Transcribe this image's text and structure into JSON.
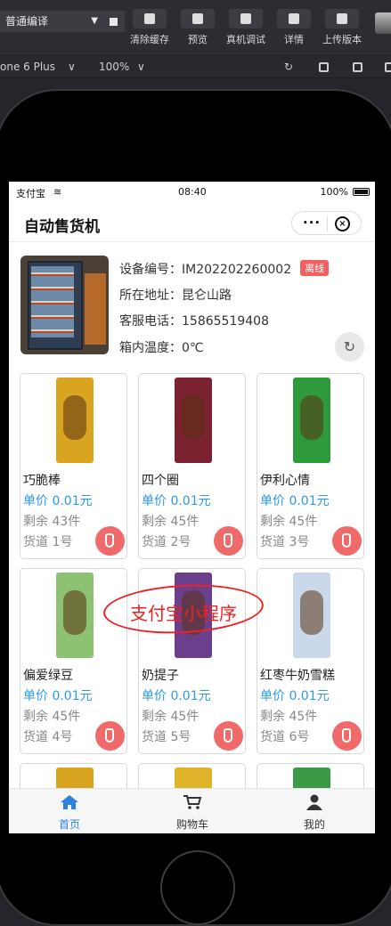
{
  "toolbar": {
    "compile_mode": "普通编译",
    "tools": [
      {
        "label": "清除缓存",
        "icon": "clear-cache-icon"
      },
      {
        "label": "预览",
        "icon": "preview-icon"
      },
      {
        "label": "真机调试",
        "icon": "debug-icon"
      },
      {
        "label": "详情",
        "icon": "details-icon"
      },
      {
        "label": "上传版本",
        "icon": "upload-icon"
      }
    ]
  },
  "device_bar": {
    "device": "one 6 Plus",
    "zoom": "100%"
  },
  "status_bar": {
    "carrier": "支付宝",
    "time": "08:40",
    "battery": "100%"
  },
  "navbar": {
    "title": "自动售货机",
    "more": "···",
    "close": "×"
  },
  "machine_info": {
    "device_no_label": "设备编号：",
    "device_no": "IM202202260002",
    "status_badge": "离线",
    "address_label": "所在地址：",
    "address": "昆仑山路",
    "phone_label": "客服电话：",
    "phone": "15865519408",
    "temp_label": "箱内温度：",
    "temp": "0℃"
  },
  "products": [
    {
      "name": "巧脆棒",
      "price": "单价 0.01元",
      "stock": "剩余 43件",
      "slot": "货道 1号",
      "color": "#d9a520"
    },
    {
      "name": "四个圈",
      "price": "单价 0.01元",
      "stock": "剩余 45件",
      "slot": "货道 2号",
      "color": "#7a2230"
    },
    {
      "name": "伊利心情",
      "price": "单价 0.01元",
      "stock": "剩余 45件",
      "slot": "货道 3号",
      "color": "#2f9a3c"
    },
    {
      "name": "偏爱绿豆",
      "price": "单价 0.01元",
      "stock": "剩余 45件",
      "slot": "货道 4号",
      "color": "#8cc272"
    },
    {
      "name": "奶提子",
      "price": "单价 0.01元",
      "stock": "剩余 45件",
      "slot": "货道 5号",
      "color": "#6a3f8c"
    },
    {
      "name": "红枣牛奶雪糕",
      "price": "单价 0.01元",
      "stock": "剩余 45件",
      "slot": "货道 6号",
      "color": "#c9d9ea"
    }
  ],
  "watermark": "支付宝小程序",
  "tabbar": [
    {
      "label": "首页",
      "icon": "home-icon",
      "active": true
    },
    {
      "label": "购物车",
      "icon": "cart-icon",
      "active": false
    },
    {
      "label": "我的",
      "icon": "user-icon",
      "active": false
    }
  ]
}
